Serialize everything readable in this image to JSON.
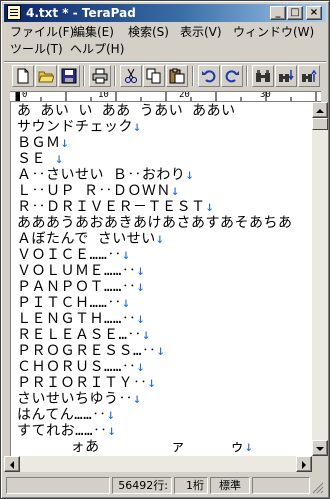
{
  "window": {
    "title": "4.txt * - TeraPad"
  },
  "menu": {
    "row1": [
      "ファイル(F)",
      "編集(E)",
      "検索(S)",
      "表示(V)",
      "ウィンドウ(W)"
    ],
    "row2": [
      "ツール(T)",
      "ヘルプ(H)"
    ]
  },
  "ruler": {
    "marks": [
      "0",
      "10",
      "20",
      "30"
    ]
  },
  "editor": {
    "lines": [
      {
        "text": "あ あい い ああ うあい ああい ",
        "eol": ""
      },
      {
        "text": "サウンドチェック",
        "eol": "↓"
      },
      {
        "text": "ＢＧＭ",
        "eol": "↓"
      },
      {
        "text": "ＳＥ ",
        "eol": "↓"
      },
      {
        "text": "Ａ‥さいせい Ｂ‥おわり",
        "eol": "↓"
      },
      {
        "text": "Ｌ‥ＵＰ Ｒ‥ＤＯＷＮ",
        "eol": "↓"
      },
      {
        "text": "Ｒ‥ＤＲＩＶＥＲ－ＴＥＳＴ",
        "eol": "↓"
      },
      {
        "text": "あああうあおあきあけあさあすあそあちあ",
        "eol": ""
      },
      {
        "text": "Ａぼたんで さいせい",
        "eol": "↓"
      },
      {
        "text": "ＶＯＩＣＥ……‥",
        "eol": "↓"
      },
      {
        "text": "ＶＯＬＵＭＥ……‥",
        "eol": "↓"
      },
      {
        "text": "ＰＡＮＰＯＴ……‥",
        "eol": "↓"
      },
      {
        "text": "ＰＩＴＣＨ……‥",
        "eol": "↓"
      },
      {
        "text": "ＬＥＮＧＴＨ……‥",
        "eol": "↓"
      },
      {
        "text": "ＲＥＬＥＡＳＥ…‥",
        "eol": "↓"
      },
      {
        "text": "ＰＲＯＧＲＥＳＳ…‥",
        "eol": "↓"
      },
      {
        "text": "ＣＨＯＲＵＳ……‥",
        "eol": "↓"
      },
      {
        "text": "ＰＲＩＯＲＩＴＹ‥",
        "eol": "↓"
      },
      {
        "text": "さいせいちゆう‥",
        "eol": "↓"
      },
      {
        "text": "はんてん……‥",
        "eol": "↓"
      },
      {
        "text": "すてれお……‥",
        "eol": "↓"
      },
      {
        "text": "      ォあ        ァ     ゥ",
        "eol": "↓"
      }
    ]
  },
  "status": {
    "line": "56492行:",
    "column": "1桁",
    "mode": "標準"
  },
  "colors": {
    "eol": "#1a6fd8",
    "title_start": "#0a246a",
    "title_end": "#a6caf0"
  }
}
